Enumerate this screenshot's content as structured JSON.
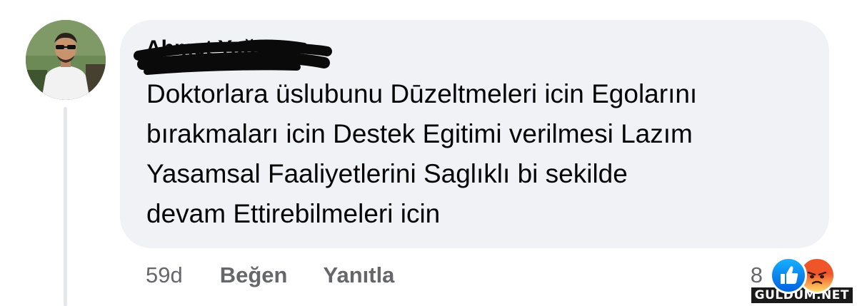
{
  "comment": {
    "author": {
      "name": "Ahmet Yağız",
      "avatar_icon": "profile-photo-icon"
    },
    "text_lines": [
      "Doktorlara üslubunu Dūzeltmeleri icin Egolarını",
      "bırakmaları icin Destek Egitimi verilmesi Lazım",
      "Yasamsal Faaliyetlerini Saglıklı bi sekilde",
      "devam Ettirebilmeleri icin"
    ],
    "timestamp": "59d",
    "like_label": "Beğen",
    "reply_label": "Yanıtla",
    "reactions": {
      "count": "8",
      "icons": [
        "like-icon",
        "angry-icon"
      ],
      "colors": {
        "like": "#1877f2",
        "angry": "#f0552a"
      }
    }
  },
  "colors": {
    "bubble": "#f0f2f5",
    "text": "#050505",
    "secondary_text": "#65676b",
    "thread_line": "#e4e6eb"
  },
  "watermark": "GULDUM.NET"
}
